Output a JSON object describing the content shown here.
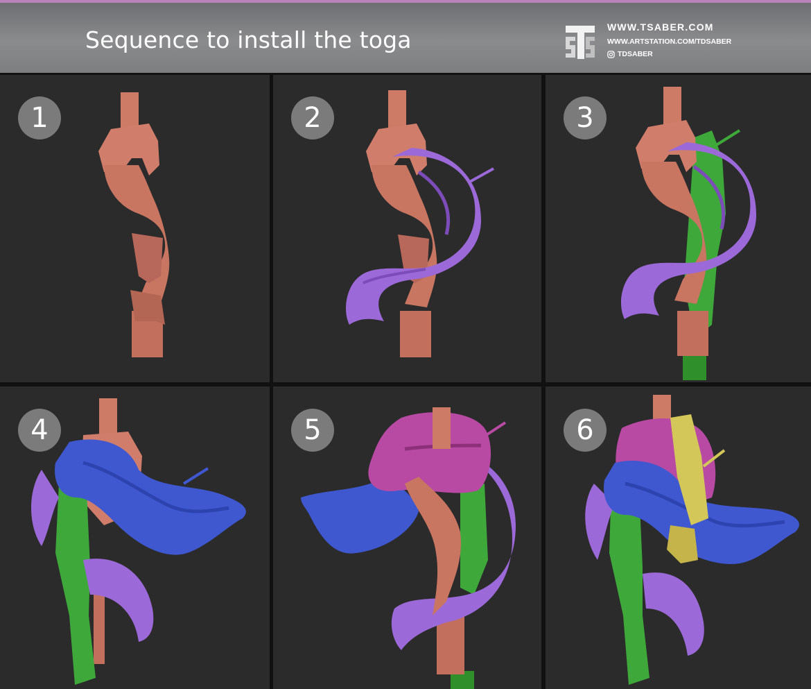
{
  "header": {
    "title": "Sequence to install the toga",
    "website": "WWW.TSABER.COM",
    "artstation": "WWW.ARTSTATION.COM/TDSABER",
    "instagram": "TDSABER"
  },
  "panels": [
    {
      "number": "1"
    },
    {
      "number": "2"
    },
    {
      "number": "3"
    },
    {
      "number": "4"
    },
    {
      "number": "5"
    },
    {
      "number": "6"
    }
  ],
  "colors": {
    "skin": "#cd7a67",
    "green": "#3ea83a",
    "lavender": "#9c6ad8",
    "blue": "#3f58d0",
    "magenta": "#b84aa4",
    "yellow": "#d4c75a",
    "panel_bg": "#2b2b2b",
    "badge": "#7b7b7b"
  }
}
